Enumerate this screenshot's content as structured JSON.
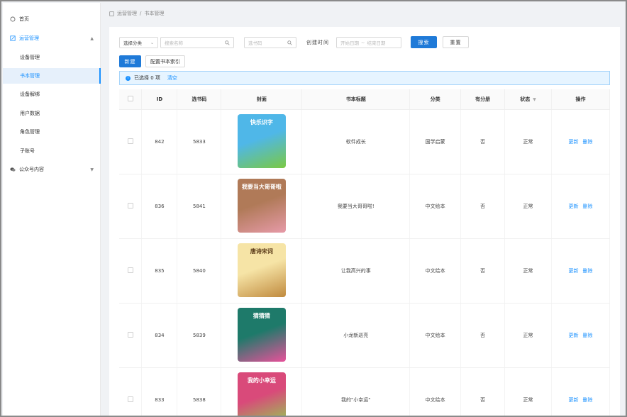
{
  "sidebar": {
    "items": [
      {
        "label": "首页",
        "icon": "home-icon"
      },
      {
        "label": "运营管理",
        "icon": "edit-icon"
      },
      {
        "label": "设备管理"
      },
      {
        "label": "书本管理"
      },
      {
        "label": "设备解绑"
      },
      {
        "label": "用户数据"
      },
      {
        "label": "角色管理"
      },
      {
        "label": "子账号"
      },
      {
        "label": "公众号内容",
        "icon": "wechat-icon"
      }
    ]
  },
  "breadcrumb": {
    "parent": "运营管理",
    "separator": "/",
    "current": "书本管理"
  },
  "filters": {
    "category_value": "选择分类",
    "search_placeholder": "搜索名称",
    "code_placeholder": "选书码",
    "date_label": "创建时间",
    "date_start_placeholder": "开始日期",
    "date_sep": "~",
    "date_end_placeholder": "结束日期",
    "search_button": "搜索",
    "reset_button": "重置"
  },
  "toolbar": {
    "new_button": "新建",
    "config_button": "配置书本索引"
  },
  "alert": {
    "text": "已选择 0 项",
    "clear": "清空"
  },
  "table": {
    "headers": [
      "ID",
      "选书码",
      "封面",
      "书本标题",
      "分类",
      "有分册",
      "状态",
      "操作"
    ],
    "rows": [
      {
        "id": "842",
        "code": "5833",
        "title": "软件成长",
        "category": "国学启蒙",
        "has_volumes": "否",
        "status": "正常",
        "cover_title": "快乐识字",
        "cover_colors": [
          "#4fb7e8",
          "#7ac943"
        ]
      },
      {
        "id": "836",
        "code": "5841",
        "title": "我要当大哥哥啦!",
        "category": "中文绘本",
        "has_volumes": "否",
        "status": "正常",
        "cover_title": "我要当大哥哥啦",
        "cover_colors": [
          "#b07a58",
          "#e69aa8"
        ]
      },
      {
        "id": "835",
        "code": "5840",
        "title": "让我高兴的事",
        "category": "中文绘本",
        "has_volumes": "否",
        "status": "正常",
        "cover_title": "唐诗宋词",
        "cover_colors": [
          "#f6e4a6",
          "#c08a3e"
        ]
      },
      {
        "id": "834",
        "code": "5839",
        "title": "小龙新巡亮",
        "category": "中文绘本",
        "has_volumes": "否",
        "status": "正常",
        "cover_title": "猜猜猜",
        "cover_colors": [
          "#1e7a6a",
          "#e8519a"
        ]
      },
      {
        "id": "833",
        "code": "5838",
        "title": "我的\"小幸运\"",
        "category": "中文绘本",
        "has_volumes": "否",
        "status": "正常",
        "cover_title": "我的小幸运",
        "cover_colors": [
          "#d94a7a",
          "#8fd14f"
        ]
      }
    ],
    "update_label": "更新",
    "delete_label": "删除"
  },
  "colors": {
    "primary": "#1f7ad8",
    "link": "#1890ff",
    "alert_bg": "#e6f4ff"
  }
}
